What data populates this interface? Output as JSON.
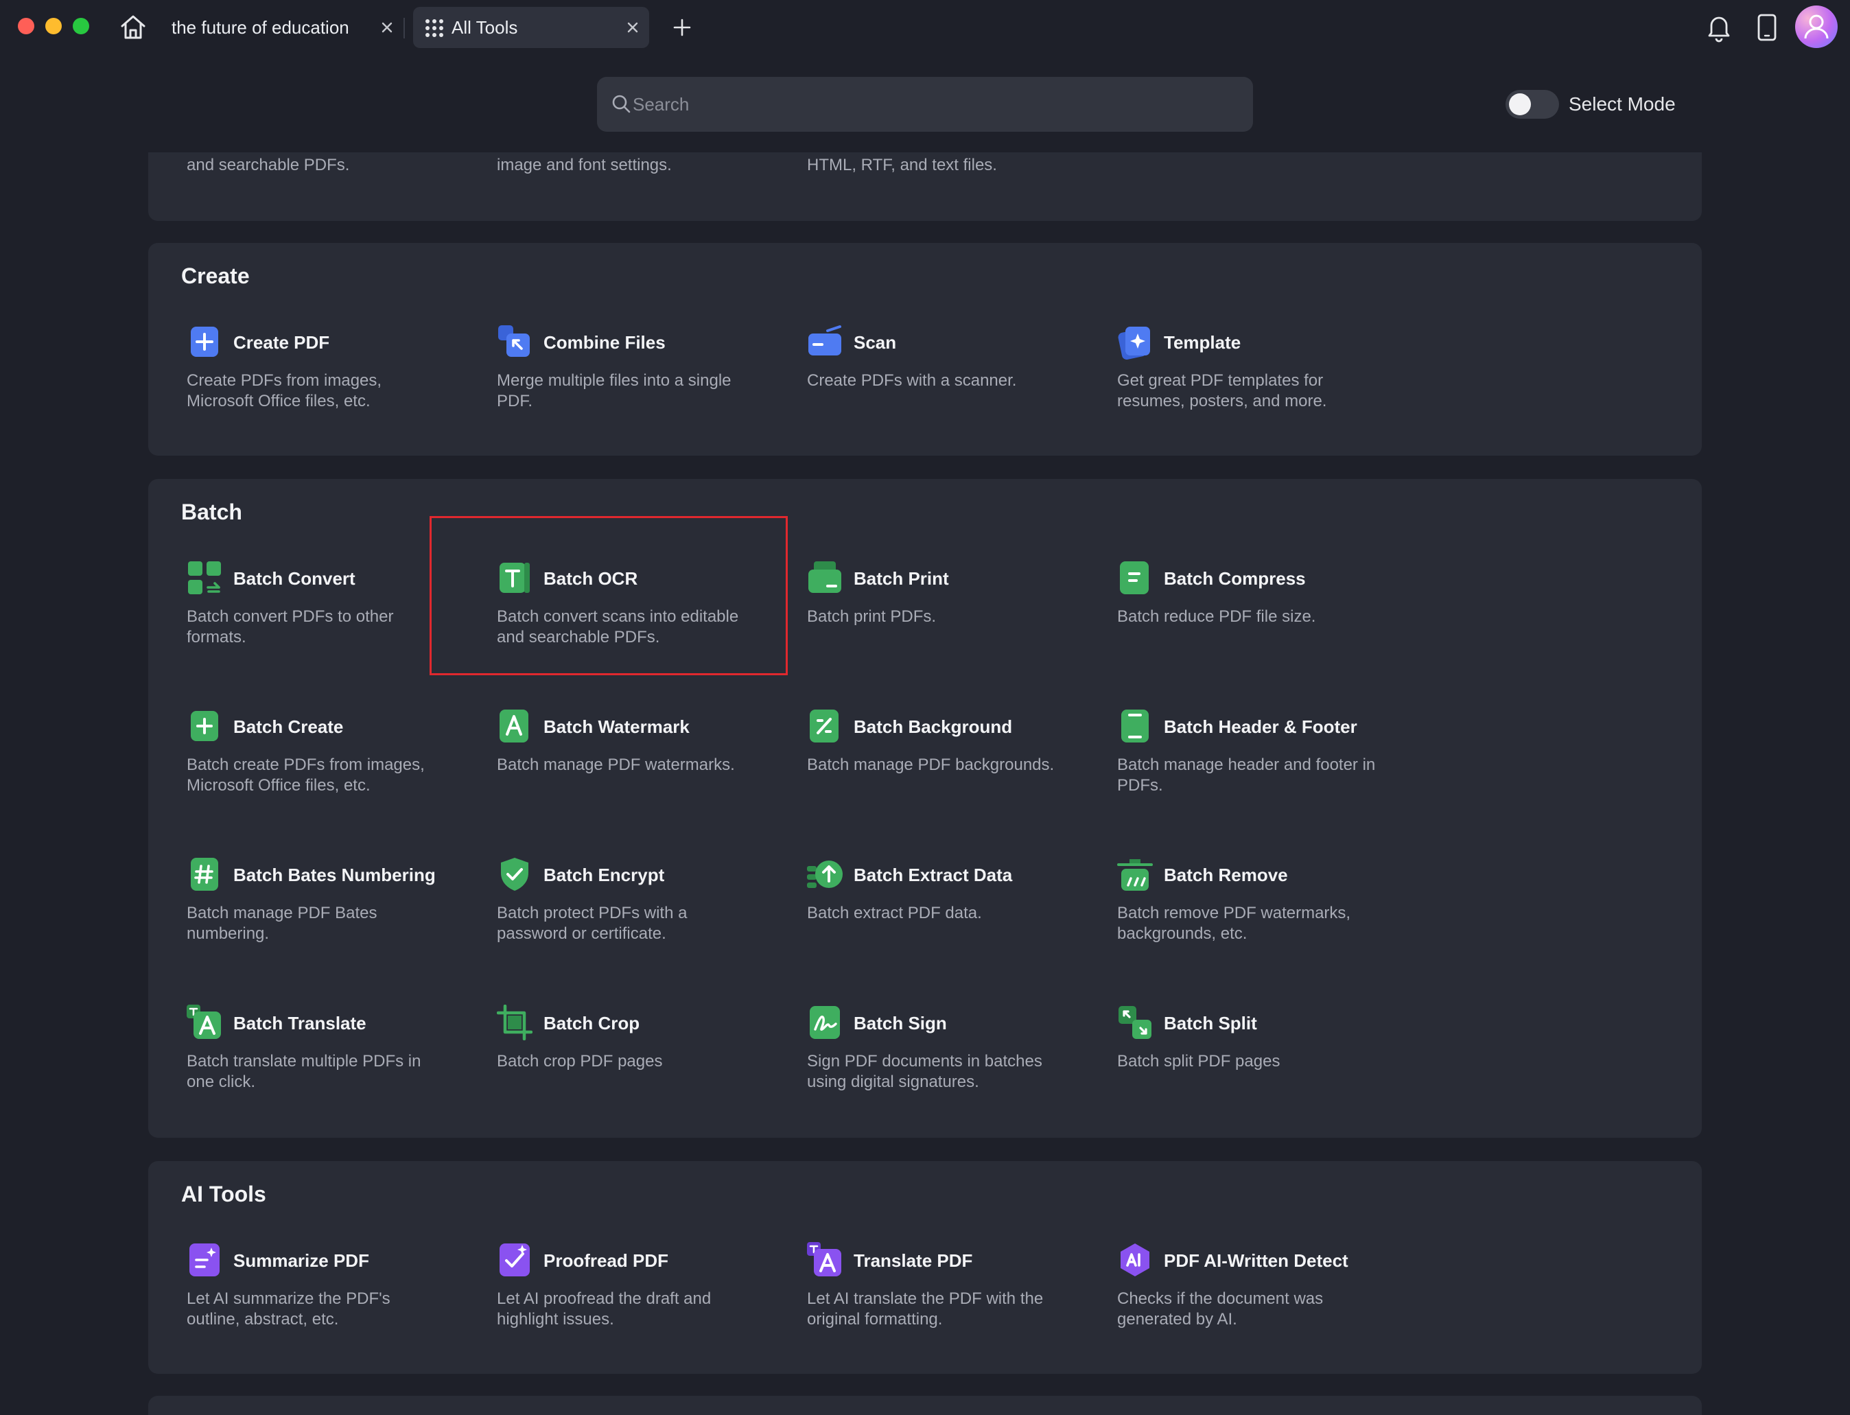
{
  "tabs": [
    {
      "label": "the future of education",
      "active": false
    },
    {
      "label": "All Tools",
      "active": true
    }
  ],
  "search": {
    "placeholder": "Search"
  },
  "select_mode_label": "Select Mode",
  "select_mode_on": false,
  "top_partial_descriptions": [
    "and searchable PDFs.",
    "image and font settings.",
    "HTML, RTF, and text files."
  ],
  "sections": {
    "create": {
      "title": "Create",
      "tools": [
        {
          "name": "Create PDF",
          "desc": "Create PDFs from images, Microsoft Office files, etc.",
          "icon": "create-pdf-icon",
          "color": "#4f7bf2"
        },
        {
          "name": "Combine Files",
          "desc": "Merge multiple files into a single PDF.",
          "icon": "combine-files-icon",
          "color": "#4f7bf2"
        },
        {
          "name": "Scan",
          "desc": "Create PDFs with a scanner.",
          "icon": "scan-icon",
          "color": "#4f7bf2"
        },
        {
          "name": "Template",
          "desc": "Get great PDF templates for resumes, posters, and more.",
          "icon": "template-icon",
          "color": "#4f7bf2"
        }
      ]
    },
    "batch": {
      "title": "Batch",
      "tools": [
        {
          "name": "Batch Convert",
          "desc": "Batch convert PDFs to other formats.",
          "icon": "batch-convert-icon",
          "color": "#3fae5f"
        },
        {
          "name": "Batch OCR",
          "desc": "Batch convert scans into editable and searchable PDFs.",
          "icon": "batch-ocr-icon",
          "color": "#3fae5f"
        },
        {
          "name": "Batch Print",
          "desc": "Batch print PDFs.",
          "icon": "batch-print-icon",
          "color": "#3fae5f"
        },
        {
          "name": "Batch Compress",
          "desc": "Batch reduce PDF file size.",
          "icon": "batch-compress-icon",
          "color": "#3fae5f"
        },
        {
          "name": "Batch Create",
          "desc": "Batch create PDFs from images, Microsoft Office files, etc.",
          "icon": "batch-create-icon",
          "color": "#3fae5f"
        },
        {
          "name": "Batch Watermark",
          "desc": "Batch manage PDF watermarks.",
          "icon": "batch-watermark-icon",
          "color": "#3fae5f"
        },
        {
          "name": "Batch Background",
          "desc": "Batch manage PDF backgrounds.",
          "icon": "batch-background-icon",
          "color": "#3fae5f"
        },
        {
          "name": "Batch Header & Footer",
          "desc": "Batch manage header and footer in PDFs.",
          "icon": "batch-header-footer-icon",
          "color": "#3fae5f"
        },
        {
          "name": "Batch Bates Numbering",
          "desc": "Batch manage PDF Bates numbering.",
          "icon": "batch-bates-numbering-icon",
          "color": "#3fae5f"
        },
        {
          "name": "Batch Encrypt",
          "desc": "Batch protect PDFs with a password or certificate.",
          "icon": "batch-encrypt-icon",
          "color": "#3fae5f"
        },
        {
          "name": "Batch Extract Data",
          "desc": "Batch extract PDF data.",
          "icon": "batch-extract-data-icon",
          "color": "#3fae5f"
        },
        {
          "name": "Batch Remove",
          "desc": "Batch remove PDF watermarks, backgrounds, etc.",
          "icon": "batch-remove-icon",
          "color": "#3fae5f"
        },
        {
          "name": "Batch Translate",
          "desc": "Batch translate multiple PDFs in one click.",
          "icon": "batch-translate-icon",
          "color": "#3fae5f"
        },
        {
          "name": "Batch Crop",
          "desc": "Batch crop PDF pages",
          "icon": "batch-crop-icon",
          "color": "#3fae5f"
        },
        {
          "name": "Batch Sign",
          "desc": "Sign PDF documents in batches using digital signatures.",
          "icon": "batch-sign-icon",
          "color": "#3fae5f"
        },
        {
          "name": "Batch Split",
          "desc": "Batch split PDF pages",
          "icon": "batch-split-icon",
          "color": "#3fae5f"
        }
      ]
    },
    "ai": {
      "title": "AI Tools",
      "tools": [
        {
          "name": "Summarize PDF",
          "desc": "Let AI summarize the PDF's outline, abstract, etc.",
          "icon": "summarize-pdf-icon",
          "color": "#8a52f0"
        },
        {
          "name": "Proofread PDF",
          "desc": "Let AI proofread the draft and highlight issues.",
          "icon": "proofread-pdf-icon",
          "color": "#8a52f0"
        },
        {
          "name": "Translate PDF",
          "desc": "Let AI translate the PDF with the original formatting.",
          "icon": "translate-pdf-icon",
          "color": "#8a52f0"
        },
        {
          "name": "PDF AI-Written Detect",
          "desc": "Checks if the document was generated by AI.",
          "icon": "ai-written-detect-icon",
          "color": "#8a52f0"
        }
      ]
    }
  },
  "highlighted_tool": "Batch OCR"
}
